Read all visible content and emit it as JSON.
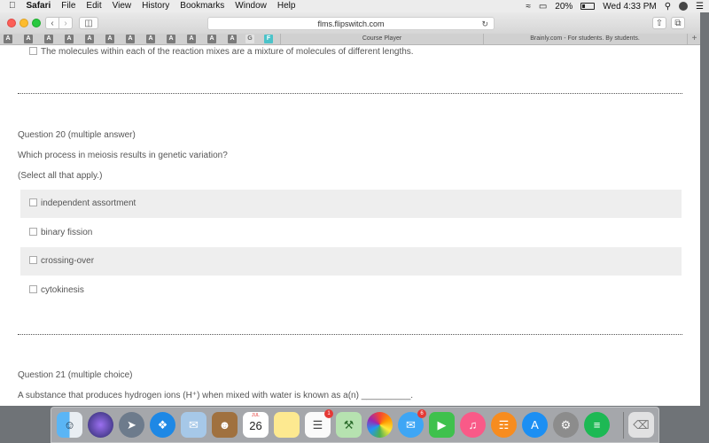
{
  "menubar": {
    "app": "Safari",
    "items": [
      "File",
      "Edit",
      "View",
      "History",
      "Bookmarks",
      "Window",
      "Help"
    ],
    "battery": "20%",
    "clock": "Wed 4:33 PM"
  },
  "browser": {
    "url": "flms.flipswitch.com",
    "favorites": [
      "A",
      "A",
      "A",
      "A",
      "A",
      "A",
      "A",
      "A",
      "A",
      "A",
      "A",
      "A",
      "G",
      "F"
    ],
    "tabs": [
      "Course Player",
      "Brainly.com - For students. By students."
    ],
    "new_tab": "+"
  },
  "page": {
    "prev_answer": "The molecules within each of the reaction mixes are a mixture of molecules of different lengths.",
    "q20": {
      "header": "Question 20 (multiple answer)",
      "prompt": "Which process in meiosis results in genetic variation?",
      "instruction": "(Select all that apply.)",
      "options": [
        "independent assortment",
        "binary fission",
        "crossing-over",
        "cytokinesis"
      ]
    },
    "q21": {
      "header": "Question 21 (multiple choice)",
      "prompt": "A substance that produces hydrogen ions (H⁺) when mixed with water is known as a(n) __________."
    }
  },
  "dock": {
    "calendar_month": "JUL",
    "calendar_day": "26",
    "reminders_badge": "1",
    "messages_badge": "6"
  },
  "colors": {
    "close": "#fc5f57",
    "minimize": "#fdbc2e",
    "zoom": "#29c840",
    "option_shade": "#eeeeee"
  }
}
